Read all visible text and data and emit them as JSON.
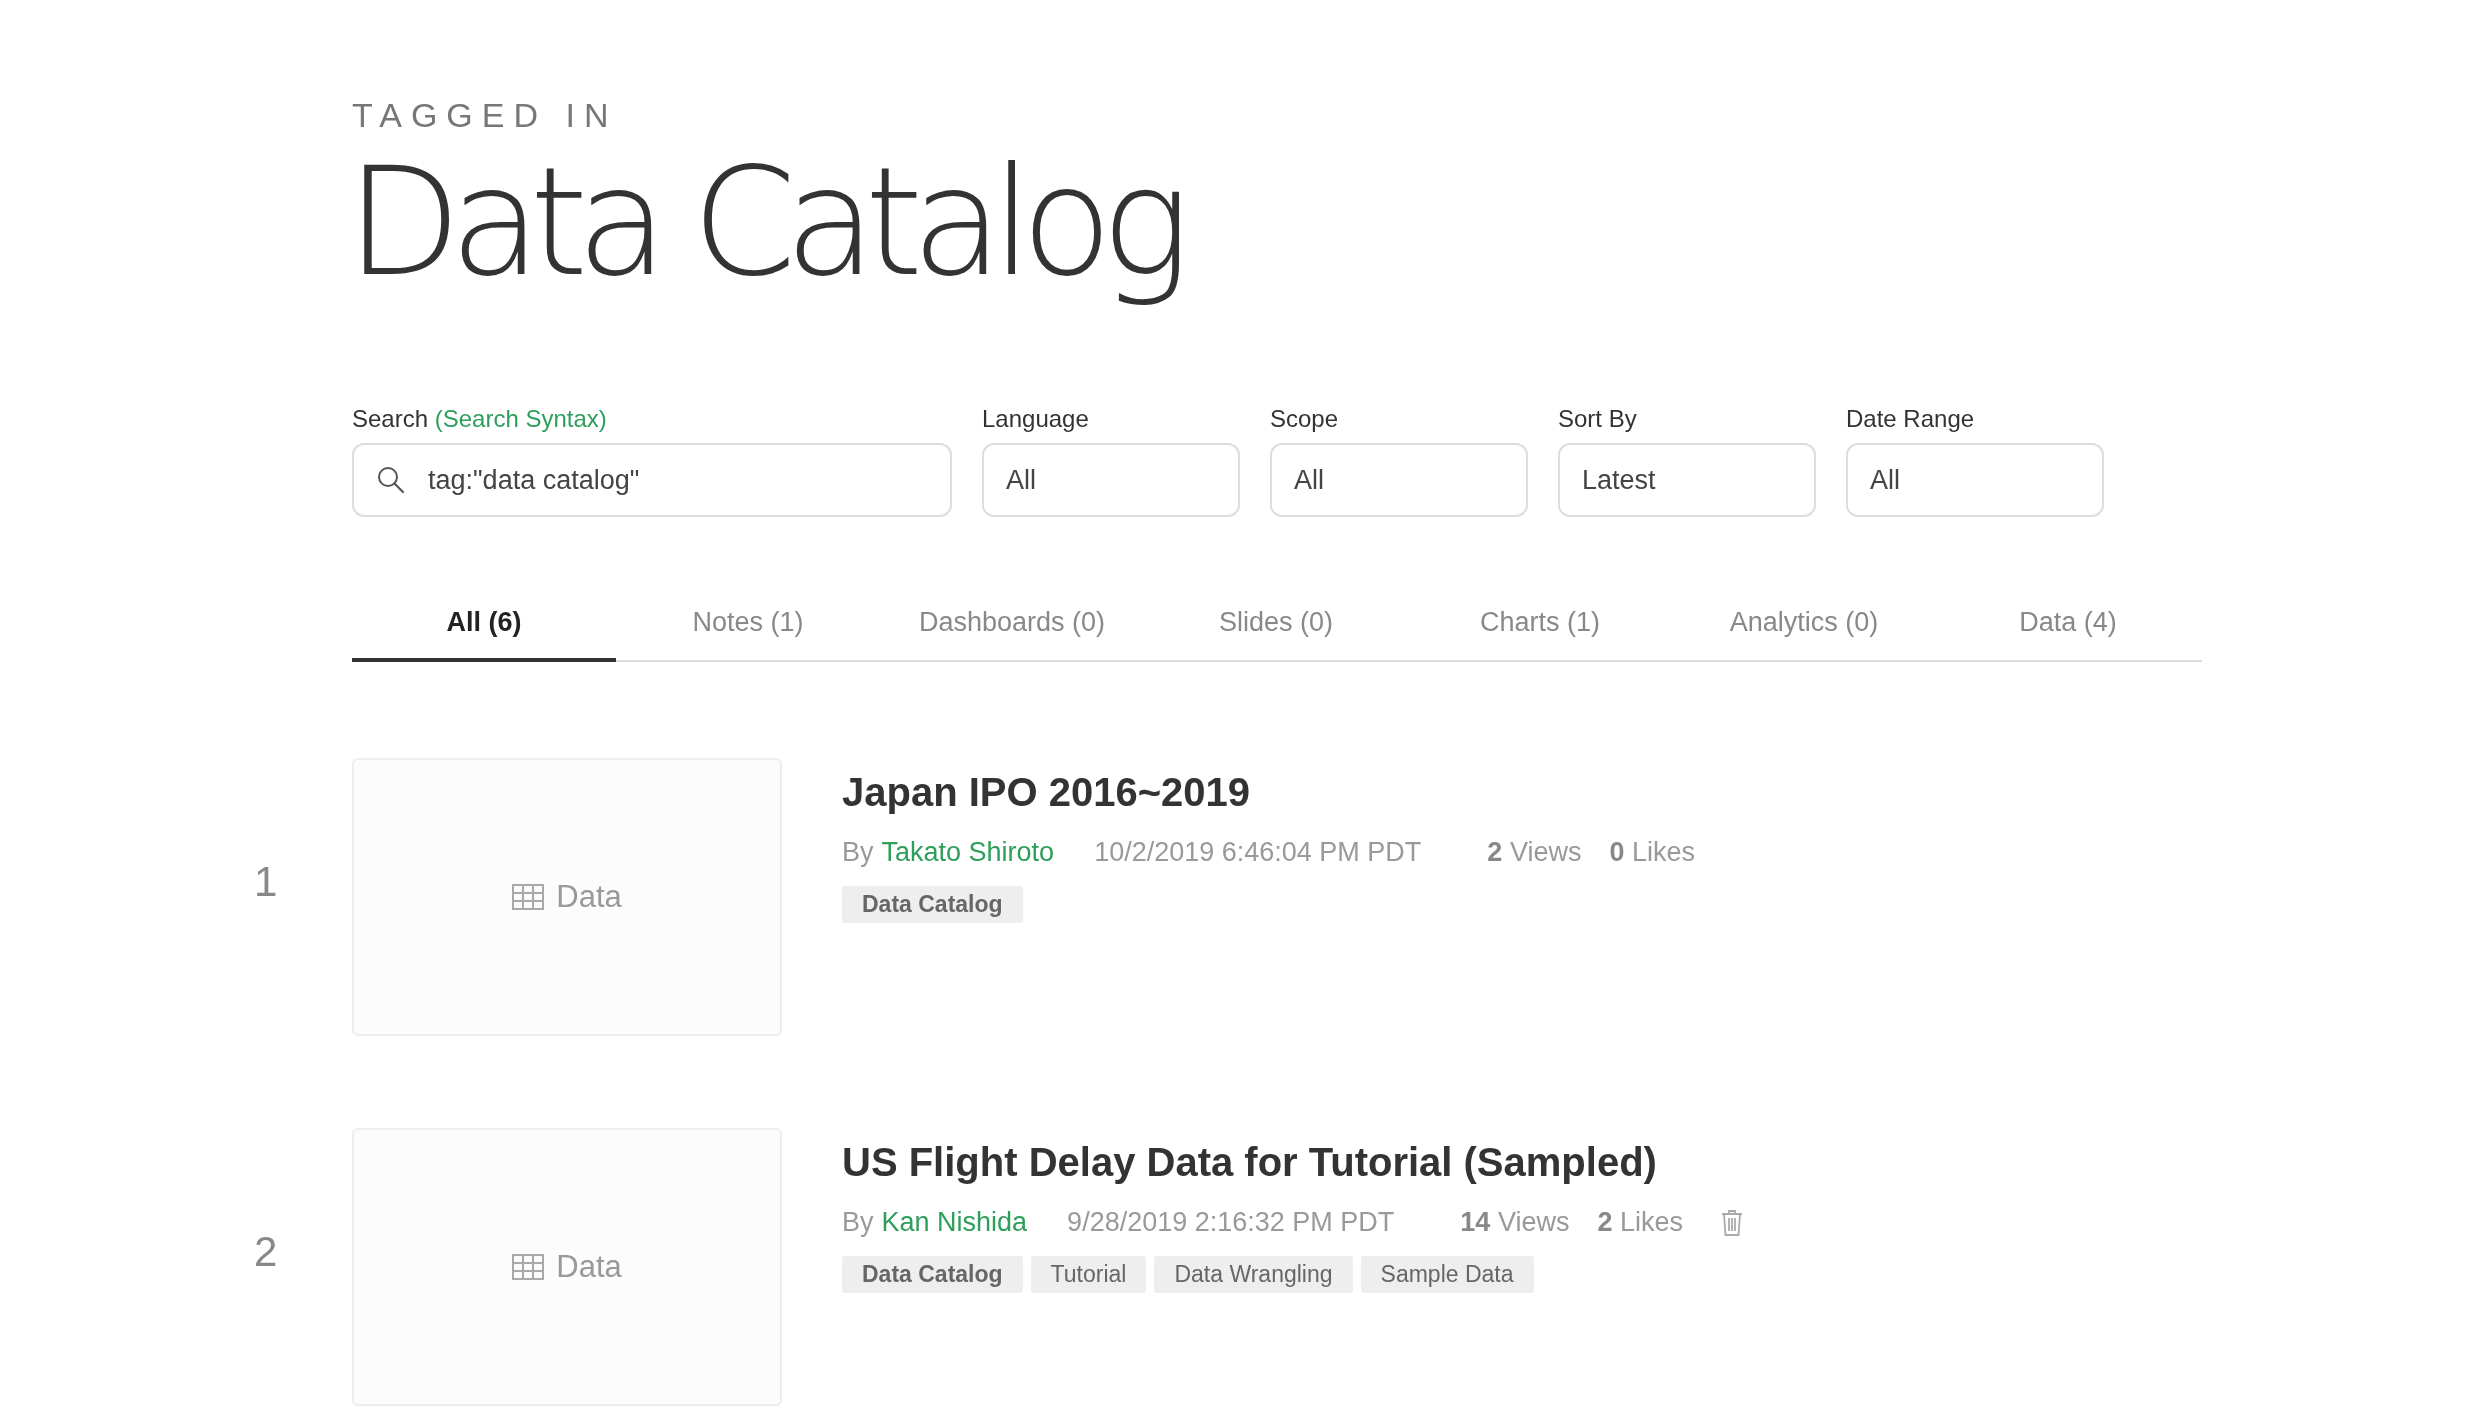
{
  "header": {
    "eyebrow": "TAGGED IN",
    "title": "Data Catalog"
  },
  "filters": {
    "search": {
      "label": "Search",
      "help_link": "(Search Syntax)",
      "value": "tag:\"data catalog\""
    },
    "selects": [
      {
        "label": "Language",
        "value": "All"
      },
      {
        "label": "Scope",
        "value": "All"
      },
      {
        "label": "Sort By",
        "value": "Latest"
      },
      {
        "label": "Date Range",
        "value": "All"
      }
    ]
  },
  "tabs": [
    {
      "label": "All (6)",
      "selected": true
    },
    {
      "label": "Notes (1)",
      "selected": false
    },
    {
      "label": "Dashboards (0)",
      "selected": false
    },
    {
      "label": "Slides (0)",
      "selected": false
    },
    {
      "label": "Charts (1)",
      "selected": false
    },
    {
      "label": "Analytics (0)",
      "selected": false
    },
    {
      "label": "Data (4)",
      "selected": false
    }
  ],
  "results": [
    {
      "index": "1",
      "thumbnail_label": "Data",
      "title": "Japan IPO 2016~2019",
      "by": "By",
      "author": "Takato Shiroto",
      "date": "10/2/2019 6:46:04 PM PDT",
      "views": "2",
      "views_label": "Views",
      "likes": "0",
      "likes_label": "Likes",
      "deletable": false,
      "tags": [
        {
          "label": "Data Catalog",
          "matched": true
        }
      ]
    },
    {
      "index": "2",
      "thumbnail_label": "Data",
      "title": "US Flight Delay Data for Tutorial (Sampled)",
      "by": "By",
      "author": "Kan Nishida",
      "date": "9/28/2019 2:16:32 PM PDT",
      "views": "14",
      "views_label": "Views",
      "likes": "2",
      "likes_label": "Likes",
      "deletable": true,
      "tags": [
        {
          "label": "Data Catalog",
          "matched": true
        },
        {
          "label": "Tutorial",
          "matched": false
        },
        {
          "label": "Data Wrangling",
          "matched": false
        },
        {
          "label": "Sample Data",
          "matched": false
        }
      ]
    }
  ]
}
